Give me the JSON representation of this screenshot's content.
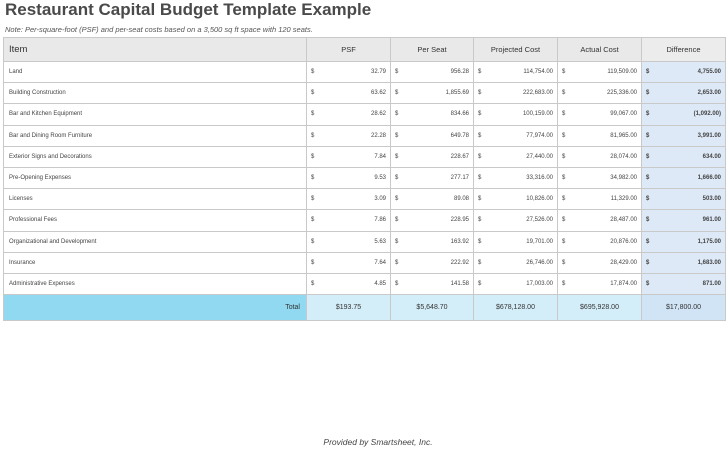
{
  "title": "Restaurant Capital Budget Template Example",
  "note": "Note: Per-square-foot (PSF) and per-seat costs based on a 3,500 sq ft space with 120 seats.",
  "currency_symbol": "$",
  "columns": {
    "item": "Item",
    "psf": "PSF",
    "per_seat": "Per Seat",
    "projected": "Projected Cost",
    "actual": "Actual Cost",
    "difference": "Difference"
  },
  "rows": [
    {
      "item": "Land",
      "psf": "32.79",
      "per_seat": "956.28",
      "projected": "114,754.00",
      "actual": "119,509.00",
      "difference": "4,755.00"
    },
    {
      "item": "Building Construction",
      "psf": "63.62",
      "per_seat": "1,855.69",
      "projected": "222,683.00",
      "actual": "225,336.00",
      "difference": "2,653.00"
    },
    {
      "item": "Bar and Kitchen Equipment",
      "psf": "28.62",
      "per_seat": "834.66",
      "projected": "100,159.00",
      "actual": "99,067.00",
      "difference": "(1,092.00)"
    },
    {
      "item": "Bar and Dining Room Furniture",
      "psf": "22.28",
      "per_seat": "649.78",
      "projected": "77,974.00",
      "actual": "81,965.00",
      "difference": "3,991.00"
    },
    {
      "item": "Exterior Signs and Decorations",
      "psf": "7.84",
      "per_seat": "228.67",
      "projected": "27,440.00",
      "actual": "28,074.00",
      "difference": "634.00"
    },
    {
      "item": "Pre-Opening Expenses",
      "psf": "9.53",
      "per_seat": "277.17",
      "projected": "33,316.00",
      "actual": "34,982.00",
      "difference": "1,666.00"
    },
    {
      "item": "Licenses",
      "psf": "3.09",
      "per_seat": "89.08",
      "projected": "10,826.00",
      "actual": "11,329.00",
      "difference": "503.00"
    },
    {
      "item": "Professional Fees",
      "psf": "7.86",
      "per_seat": "228.95",
      "projected": "27,526.00",
      "actual": "28,487.00",
      "difference": "961.00"
    },
    {
      "item": "Organizational and Development",
      "psf": "5.63",
      "per_seat": "163.92",
      "projected": "19,701.00",
      "actual": "20,876.00",
      "difference": "1,175.00"
    },
    {
      "item": "Insurance",
      "psf": "7.64",
      "per_seat": "222.92",
      "projected": "26,746.00",
      "actual": "28,429.00",
      "difference": "1,683.00"
    },
    {
      "item": "Administrative Expenses",
      "psf": "4.85",
      "per_seat": "141.58",
      "projected": "17,003.00",
      "actual": "17,874.00",
      "difference": "871.00"
    }
  ],
  "totals": {
    "label": "Total",
    "psf": "$193.75",
    "per_seat": "$5,648.70",
    "projected": "$678,128.00",
    "actual": "$695,928.00",
    "difference": "$17,800.00"
  },
  "colors": {
    "header_bg": "#e9e9e9",
    "difference_bg": "#dde9f6",
    "total_label_bg": "#90d9f0",
    "total_row_bg": "#d4eef9"
  },
  "footer": "Provided by Smartsheet, Inc."
}
